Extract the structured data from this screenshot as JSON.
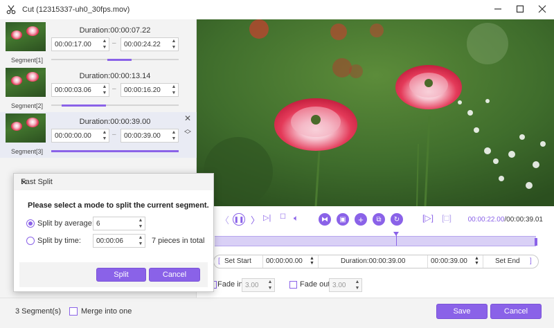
{
  "window": {
    "title": "Cut (12315337-uh0_30fps.mov)",
    "minimize_icon": "minimize-icon",
    "maximize_icon": "maximize-icon",
    "close_icon": "close-icon"
  },
  "segments": [
    {
      "label": "Segment[1]",
      "duration": "Duration:00:00:07.22",
      "start": "00:00:17.00",
      "end": "00:00:24.22",
      "bar_start": 0.44,
      "bar_end": 0.63,
      "active": false
    },
    {
      "label": "Segment[2]",
      "duration": "Duration:00:00:13.14",
      "start": "00:00:03.06",
      "end": "00:00:16.20",
      "bar_start": 0.08,
      "bar_end": 0.43,
      "active": false
    },
    {
      "label": "Segment[3]",
      "duration": "Duration:00:00:39.00",
      "start": "00:00:00.00",
      "end": "00:00:39.00",
      "bar_start": 0.0,
      "bar_end": 1.0,
      "active": true
    }
  ],
  "player": {
    "current_time": "00:00:22.00",
    "total_time": "/00:00:39.01",
    "playhead_fraction": 0.564
  },
  "setrow": {
    "set_start": "Set Start",
    "start_value": "00:00:00.00",
    "duration": "Duration:00:00:39.00",
    "end_value": "00:00:39.00",
    "set_end": "Set End"
  },
  "fade": {
    "fade_in_label": "Fade in",
    "fade_in_value": "3.00",
    "fade_out_label": "Fade out",
    "fade_out_value": "3.00"
  },
  "bottom": {
    "segment_count": "3 Segment(s)",
    "merge_label": "Merge into one",
    "save": "Save",
    "cancel": "Cancel"
  },
  "dialog": {
    "title": "Fast Split",
    "prompt": "Please select a mode to split the current segment.",
    "by_average_label": "Split by average:",
    "by_average_value": "6",
    "by_time_label": "Split by time:",
    "by_time_value": "00:00:06",
    "pieces_text": "7 pieces in total",
    "split": "Split",
    "cancel": "Cancel"
  },
  "colors": {
    "accent": "#8a62e8",
    "timeline": "#d9d0f6"
  }
}
